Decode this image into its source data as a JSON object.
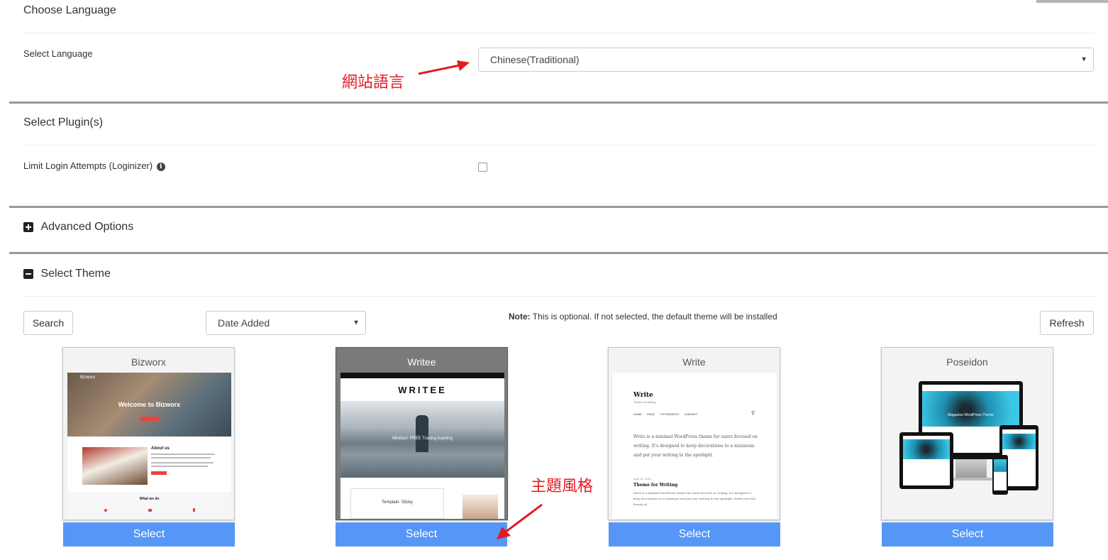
{
  "language_section": {
    "title": "Choose Language",
    "label": "Select Language",
    "selected": "Chinese(Traditional)",
    "annotation": "網站語言"
  },
  "plugins_section": {
    "title": "Select Plugin(s)",
    "plugin_label": "Limit Login Attempts (Loginizer)"
  },
  "advanced": {
    "title": "Advanced Options"
  },
  "theme_section": {
    "title": "Select Theme",
    "search_label": "Search",
    "sort_selected": "Date Added",
    "note_label": "Note:",
    "note_text": "This is optional. If not selected, the default theme will be installed",
    "refresh_label": "Refresh",
    "annotation": "主題風格",
    "themes": [
      {
        "name": "Bizworx",
        "select_label": "Select",
        "preview": {
          "brand": "Bizworx",
          "hero": "Welcome to Bizworx",
          "about": "About us",
          "what": "What we do"
        }
      },
      {
        "name": "Writee",
        "select_label": "Select",
        "preview": {
          "logo": "WRITEE",
          "caption": "Mindset: FREE Tracing Aspiring",
          "post": "Template: Sticky"
        }
      },
      {
        "name": "Write",
        "select_label": "Select",
        "preview": {
          "logo": "Write",
          "tagline": "Theme for Writing",
          "nav": [
            "HOME",
            "PAGE",
            "TYPOGRAPHY",
            "CONTACT"
          ],
          "intro": "Write is a minimal WordPress theme for users focused on writing. It's designed to keep decorations to a minimum and put your writing in the spotlight.",
          "date": "April 21, 2015",
          "post_title": "Theme for Writing",
          "excerpt": "Write is a minimal WordPress theme for users focused on writing. It's designed to keep decorations to a minimum and put your writing in the spotlight. Rediscover the beauty of..."
        }
      },
      {
        "name": "Poseidon",
        "select_label": "Select",
        "preview": {
          "hero": "Magazine WordPress Theme"
        }
      }
    ]
  },
  "colors": {
    "select_button": "#5596f7",
    "annotation": "#e31b23",
    "divider_heavy": "#999999"
  }
}
